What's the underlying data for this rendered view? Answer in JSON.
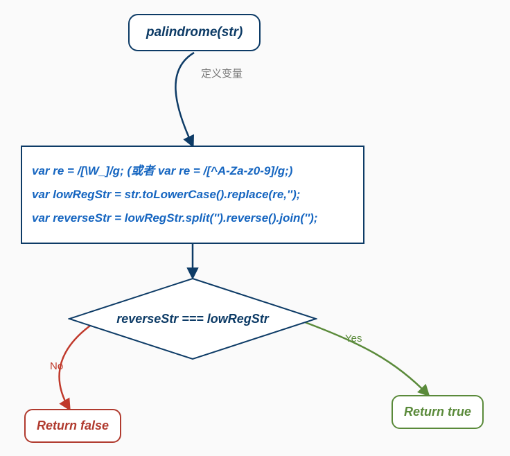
{
  "chart_data": {
    "type": "flowchart",
    "nodes": [
      {
        "id": "start",
        "kind": "start",
        "label": "palindrome(str)"
      },
      {
        "id": "process",
        "kind": "process",
        "lines": [
          "var re = /[\\W_]/g; (或者 var re = /[^A-Za-z0-9]/g;)",
          "var lowRegStr = str.toLowerCase().replace(re,'');",
          "var reverseStr = lowRegStr.split('').reverse().join('');"
        ]
      },
      {
        "id": "decision",
        "kind": "decision",
        "label": "reverseStr === lowRegStr"
      },
      {
        "id": "return_false",
        "kind": "end",
        "label": "Return false"
      },
      {
        "id": "return_true",
        "kind": "end",
        "label": "Return true"
      }
    ],
    "edges": [
      {
        "from": "start",
        "to": "process",
        "label": "定义变量"
      },
      {
        "from": "process",
        "to": "decision",
        "label": ""
      },
      {
        "from": "decision",
        "to": "return_false",
        "label": "No"
      },
      {
        "from": "decision",
        "to": "return_true",
        "label": "Yes"
      }
    ]
  },
  "start": {
    "label": "palindrome(str)"
  },
  "process": {
    "line1": "var re = /[\\W_]/g; (或者 var re = /[^A-Za-z0-9]/g;)",
    "line2": "var lowRegStr = str.toLowerCase().replace(re,'');",
    "line3": "var reverseStr = lowRegStr.split('').reverse().join('');"
  },
  "decision": {
    "label": "reverseStr === lowRegStr"
  },
  "end_false": {
    "label": "Return false"
  },
  "end_true": {
    "label": "Return true"
  },
  "edge_labels": {
    "start_process": "定义变量",
    "no": "No",
    "yes": "Yes"
  }
}
